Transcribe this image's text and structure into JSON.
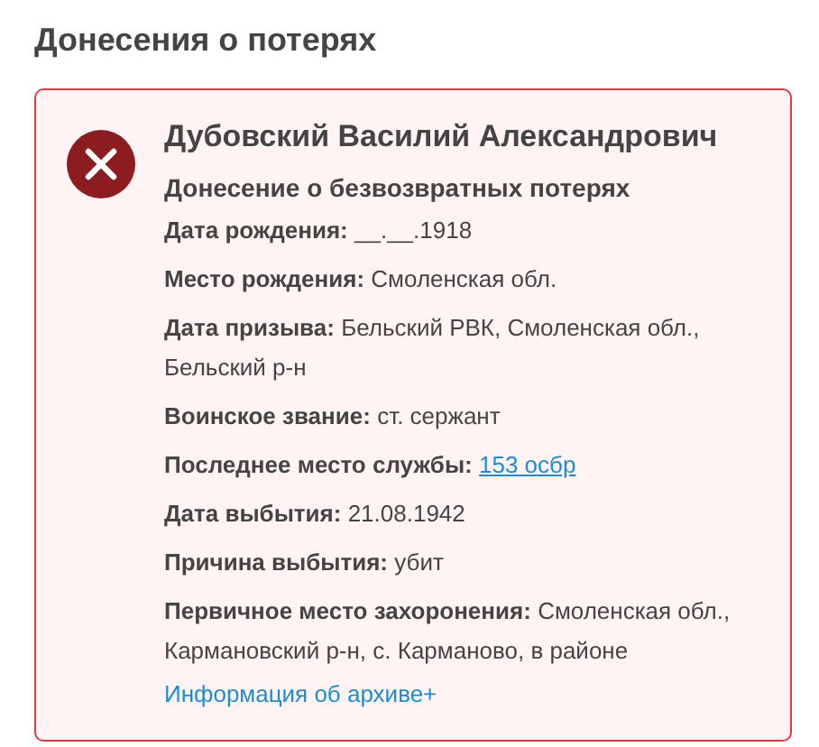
{
  "heading": "Донесения о потерях",
  "card": {
    "error": true,
    "name": "Дубовский Василий Александрович",
    "subtitle": "Донесение о безвозвратных потерях",
    "fields": [
      {
        "label": "Дата рождения:",
        "value": "__.__.1918",
        "kind": "text"
      },
      {
        "label": "Место рождения:",
        "value": "Смоленская обл.",
        "kind": "text"
      },
      {
        "label": "Дата призыва:",
        "value": "Бельский РВК, Смоленская обл., Бельский р-н",
        "kind": "text"
      },
      {
        "label": "Воинское звание:",
        "value": "ст. сержант",
        "kind": "text"
      },
      {
        "label": "Последнее место службы:",
        "value": "153 осбр",
        "kind": "link"
      },
      {
        "label": "Дата выбытия:",
        "value": "21.08.1942",
        "kind": "text"
      },
      {
        "label": "Причина выбытия:",
        "value": "убит",
        "kind": "text"
      },
      {
        "label": "Первичное место захоронения:",
        "value": "Смоленская обл., Кармановский р-н, с. Карманово, в районе",
        "kind": "text"
      }
    ],
    "archive_link": "Информация об архиве+"
  }
}
